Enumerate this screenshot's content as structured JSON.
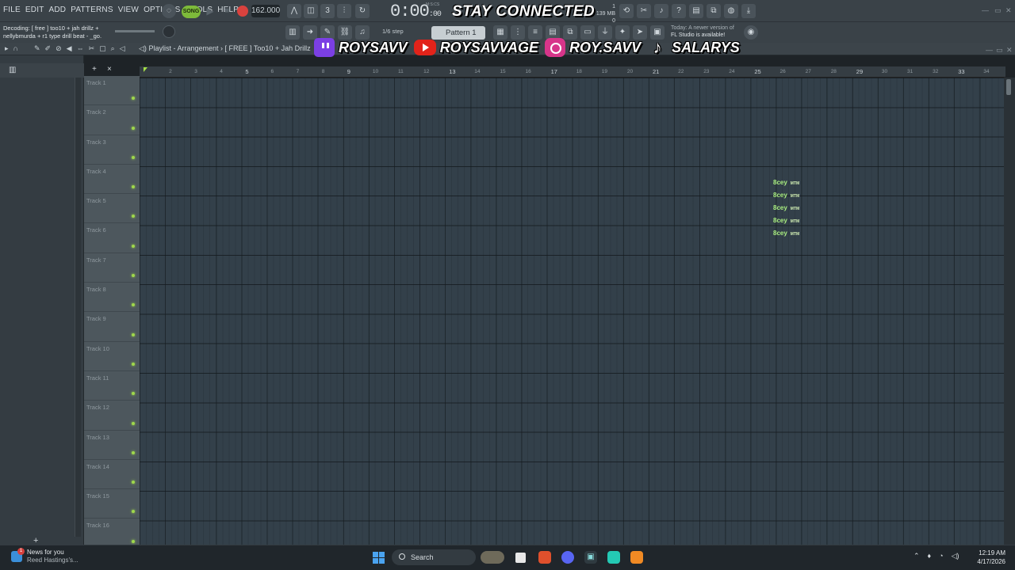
{
  "menu": [
    "FILE",
    "EDIT",
    "ADD",
    "PATTERNS",
    "VIEW",
    "OPTIONS",
    "TOOLS",
    "HELP"
  ],
  "transport": {
    "song_mode": "SONG",
    "tempo": "162.000",
    "time": "0:00",
    "time_sub": ":00",
    "time_units": "M:S:CS"
  },
  "memory": {
    "mem": "139 MB",
    "count": "0",
    "bars_top": "1"
  },
  "banner": {
    "headline": "STAY CONNECTED",
    "twitch": "ROYSAVV",
    "youtube": "ROYSAVVAGE",
    "instagram": "ROY.SAVV",
    "tiktok": "SALARYS"
  },
  "hint": {
    "line1": "Decoding: [ free ] too10 + jah drillz +",
    "line2": "nellybmurda + r1 type drill beat - _go."
  },
  "snap": "1/6 step",
  "pattern": "Pattern 1",
  "notice": {
    "line1": "Today: A newer version of",
    "line2": "FL Studio is available!"
  },
  "playlist": {
    "title": "Playlist - Arrangement",
    "breadcrumb": "[ FREE ] Too10 + Jah Drillz"
  },
  "ruler": [
    "2",
    "3",
    "4",
    "5",
    "6",
    "7",
    "8",
    "9",
    "10",
    "11",
    "12",
    "13",
    "14",
    "15",
    "16",
    "17",
    "18",
    "19",
    "20",
    "21",
    "22",
    "23",
    "24",
    "25",
    "26",
    "27",
    "28",
    "29",
    "30",
    "31",
    "32",
    "33",
    "34"
  ],
  "tracks": [
    "Track 1",
    "Track 2",
    "Track 3",
    "Track 4",
    "Track 5",
    "Track 6",
    "Track 7",
    "Track 8",
    "Track 9",
    "Track 10",
    "Track 11",
    "Track 12",
    "Track 13",
    "Track 14",
    "Track 15",
    "Track 16"
  ],
  "watermark": {
    "name": "8cey",
    "small": "MTM"
  },
  "taskbar": {
    "news_title": "News for you",
    "news_sub": "Reed Hastings's...",
    "news_badge": "1",
    "search": "Search",
    "time": "12:19 AM",
    "date": "4/17/2026"
  }
}
